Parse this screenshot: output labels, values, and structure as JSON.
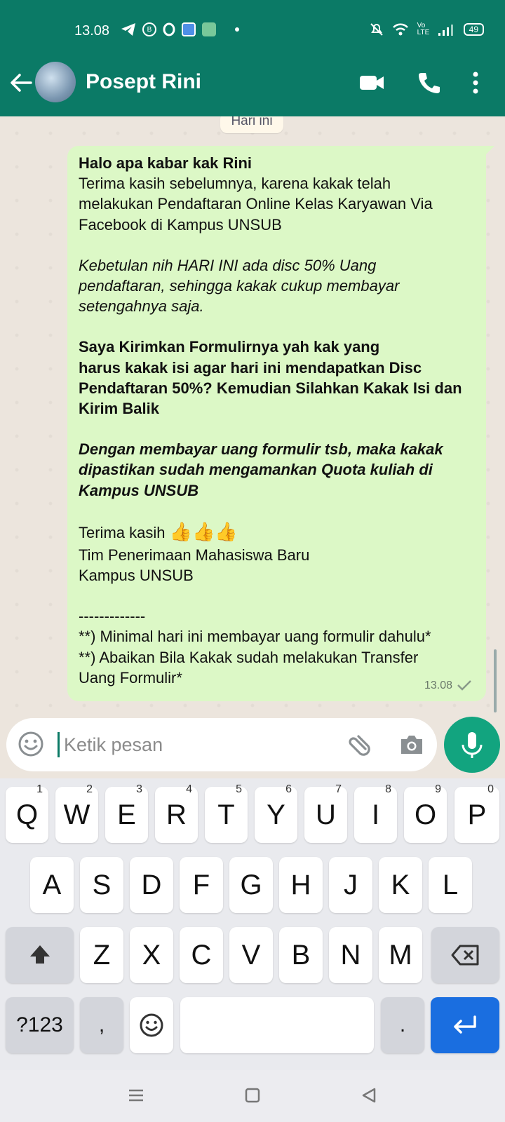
{
  "status_bar": {
    "time": "13.08",
    "battery": "49",
    "notif_b_label": "B",
    "network_label": "Vo LTE"
  },
  "header": {
    "contact_name": "Posept Rini"
  },
  "chat": {
    "date_chip": "Hari ini",
    "message": {
      "greeting": "Halo apa kabar kak Rini",
      "p1": "Terima kasih sebelumnya, karena kakak telah\nmelakukan Pendaftaran Online Kelas Karyawan Via\nFacebook di Kampus UNSUB",
      "p2": "Kebetulan nih HARI INI ada disc 50% Uang\npendaftaran, sehingga kakak cukup membayar\nsetengahnya saja.",
      "p3": "Saya Kirimkan Formulirnya yah kak yang\nharus kakak isi agar hari ini mendapatkan Disc\nPendaftaran 50%? Kemudian Silahkan Kakak Isi dan\nKirim Balik",
      "p4": "Dengan membayar uang formulir tsb, maka kakak\ndipastikan sudah mengamankan Quota kuliah di\nKampus UNSUB",
      "thanks": "Terima kasih ",
      "thumbs": "👍👍👍",
      "signature": "Tim Penerimaan Mahasiswa Baru\nKampus UNSUB",
      "separator": "-------------",
      "note1": "**) Minimal hari ini membayar uang formulir dahulu*",
      "note2": "**) Abaikan Bila Kakak sudah melakukan Transfer\nUang Formulir*",
      "time": "13.08"
    }
  },
  "composer": {
    "placeholder": "Ketik pesan"
  },
  "keyboard": {
    "row1": [
      {
        "label": "Q",
        "num": "1"
      },
      {
        "label": "W",
        "num": "2"
      },
      {
        "label": "E",
        "num": "3"
      },
      {
        "label": "R",
        "num": "4"
      },
      {
        "label": "T",
        "num": "5"
      },
      {
        "label": "Y",
        "num": "6"
      },
      {
        "label": "U",
        "num": "7"
      },
      {
        "label": "I",
        "num": "8"
      },
      {
        "label": "O",
        "num": "9"
      },
      {
        "label": "P",
        "num": "0"
      }
    ],
    "row2": [
      "A",
      "S",
      "D",
      "F",
      "G",
      "H",
      "J",
      "K",
      "L"
    ],
    "row3": [
      "Z",
      "X",
      "C",
      "V",
      "B",
      "N",
      "M"
    ],
    "symbols_label": "?123",
    "comma_label": ",",
    "period_label": "."
  },
  "colors": {
    "header": "#0b7a66",
    "bubble": "#dcf8c6",
    "mic": "#12a47f",
    "enter_key": "#1a6ee0"
  }
}
